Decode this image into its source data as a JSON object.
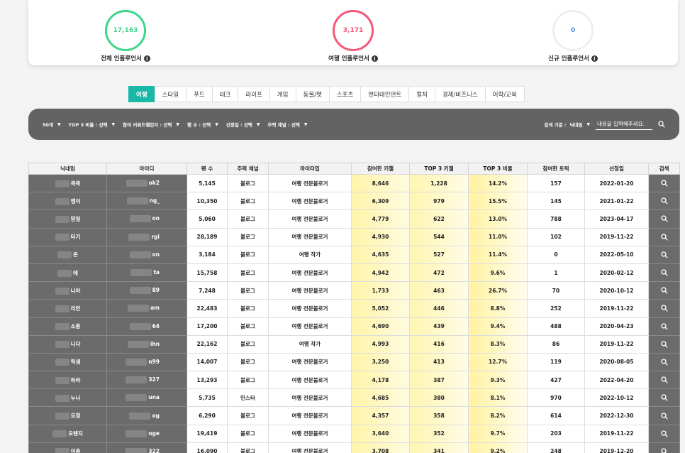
{
  "stats": [
    {
      "value": "17,163",
      "label": "전체 인플루언서",
      "color": "#3dd68c"
    },
    {
      "value": "3,171",
      "label": "여행 인플루언서",
      "color": "#f5577a"
    },
    {
      "value": "0",
      "label": "신규 인플루언서",
      "color": "#eeeeee"
    }
  ],
  "info_icon": "i",
  "tabs": [
    "여행",
    "스타일",
    "푸드",
    "테크",
    "라이프",
    "게임",
    "동물/펫",
    "스포츠",
    "엔터테인먼트",
    "컬처",
    "경제/비즈니스",
    "어학/교육"
  ],
  "filters": [
    {
      "label": "50개"
    },
    {
      "label": "TOP 3 비율 : 선택"
    },
    {
      "label": "참여 키워드챌린지 : 선택"
    },
    {
      "label": "팬 수 : 선택"
    },
    {
      "label": "선정일 : 선택"
    },
    {
      "label": "주력 채널 : 선택"
    }
  ],
  "search": {
    "label": "검색 기준 :",
    "criterion": "닉네임",
    "placeholder": "내용을 입력해주세요."
  },
  "columns": [
    "닉네임",
    "아이디",
    "팬 수",
    "주력 채널",
    "마이타입",
    "참여한 키챌",
    "TOP 3 키챌",
    "TOP 3 비율",
    "참여한 토픽",
    "선정일",
    "검색"
  ],
  "rows": [
    {
      "nick": "콕콕",
      "id": "ok2",
      "fans": "5,145",
      "channel": "블로그",
      "type": "여행 전문블로거",
      "joined": "8,646",
      "top3": "1,228",
      "ratio": "14.2%",
      "topics": "157",
      "date": "2022-01-20"
    },
    {
      "nick": "엥이",
      "id": "ng_",
      "fans": "10,350",
      "channel": "블로그",
      "type": "여행 전문블로거",
      "joined": "6,309",
      "top3": "979",
      "ratio": "15.5%",
      "topics": "145",
      "date": "2021-01-22"
    },
    {
      "nick": "망청",
      "id": "on",
      "fans": "5,060",
      "channel": "블로그",
      "type": "여행 전문블로거",
      "joined": "4,779",
      "top3": "622",
      "ratio": "13.0%",
      "topics": "788",
      "date": "2023-04-17"
    },
    {
      "nick": "터기",
      "id": "rgi",
      "fans": "28,189",
      "channel": "블로그",
      "type": "여행 전문블로거",
      "joined": "4,930",
      "top3": "544",
      "ratio": "11.0%",
      "topics": "102",
      "date": "2019-11-22"
    },
    {
      "nick": "온",
      "id": "on",
      "fans": "3,184",
      "channel": "블로그",
      "type": "여행 작가",
      "joined": "4,635",
      "top3": "527",
      "ratio": "11.4%",
      "topics": "0",
      "date": "2022-05-10"
    },
    {
      "nick": "에",
      "id": "ta",
      "fans": "15,758",
      "channel": "블로그",
      "type": "여행 전문블로거",
      "joined": "4,942",
      "top3": "472",
      "ratio": "9.6%",
      "topics": "1",
      "date": "2020-02-12"
    },
    {
      "nick": "니아",
      "id": "89",
      "fans": "7,248",
      "channel": "블로그",
      "type": "여행 전문블로거",
      "joined": "1,733",
      "top3": "463",
      "ratio": "26.7%",
      "topics": "70",
      "date": "2020-10-12"
    },
    {
      "nick": "리안",
      "id": "am",
      "fans": "22,483",
      "channel": "블로그",
      "type": "여행 전문블로거",
      "joined": "5,052",
      "top3": "446",
      "ratio": "8.8%",
      "topics": "252",
      "date": "2019-11-22"
    },
    {
      "nick": "소풍",
      "id": "64",
      "fans": "17,200",
      "channel": "블로그",
      "type": "여행 전문블로거",
      "joined": "4,690",
      "top3": "439",
      "ratio": "9.4%",
      "topics": "488",
      "date": "2020-04-23"
    },
    {
      "nick": "니다",
      "id": "ihn",
      "fans": "22,162",
      "channel": "블로그",
      "type": "여행 작가",
      "joined": "4,993",
      "top3": "416",
      "ratio": "8.3%",
      "topics": "86",
      "date": "2019-11-22"
    },
    {
      "nick": "릭샘",
      "id": "n99",
      "fans": "14,007",
      "channel": "블로그",
      "type": "여행 전문블로거",
      "joined": "3,250",
      "top3": "413",
      "ratio": "12.7%",
      "topics": "119",
      "date": "2020-08-05"
    },
    {
      "nick": "하라",
      "id": "327",
      "fans": "13,293",
      "channel": "블로그",
      "type": "여행 전문블로거",
      "joined": "4,178",
      "top3": "387",
      "ratio": "9.3%",
      "topics": "427",
      "date": "2022-04-20"
    },
    {
      "nick": "누나",
      "id": "una",
      "fans": "5,735",
      "channel": "인스타",
      "type": "여행 전문블로거",
      "joined": "4,685",
      "top3": "380",
      "ratio": "8.1%",
      "topics": "970",
      "date": "2022-10-12"
    },
    {
      "nick": "요정",
      "id": "og",
      "fans": "6,290",
      "channel": "블로그",
      "type": "여행 전문블로거",
      "joined": "4,357",
      "top3": "358",
      "ratio": "8.2%",
      "topics": "614",
      "date": "2022-12-30"
    },
    {
      "nick": "오렌지",
      "id": "nge",
      "fans": "19,419",
      "channel": "블로그",
      "type": "여행 전문블로거",
      "joined": "3,640",
      "top3": "352",
      "ratio": "9.7%",
      "topics": "203",
      "date": "2019-11-22"
    },
    {
      "nick": "이충",
      "id": "322",
      "fans": "16,090",
      "channel": "블로그",
      "type": "여행 전문블로거",
      "joined": "3,708",
      "top3": "341",
      "ratio": "9.2%",
      "topics": "248",
      "date": "2019-12-20"
    }
  ]
}
